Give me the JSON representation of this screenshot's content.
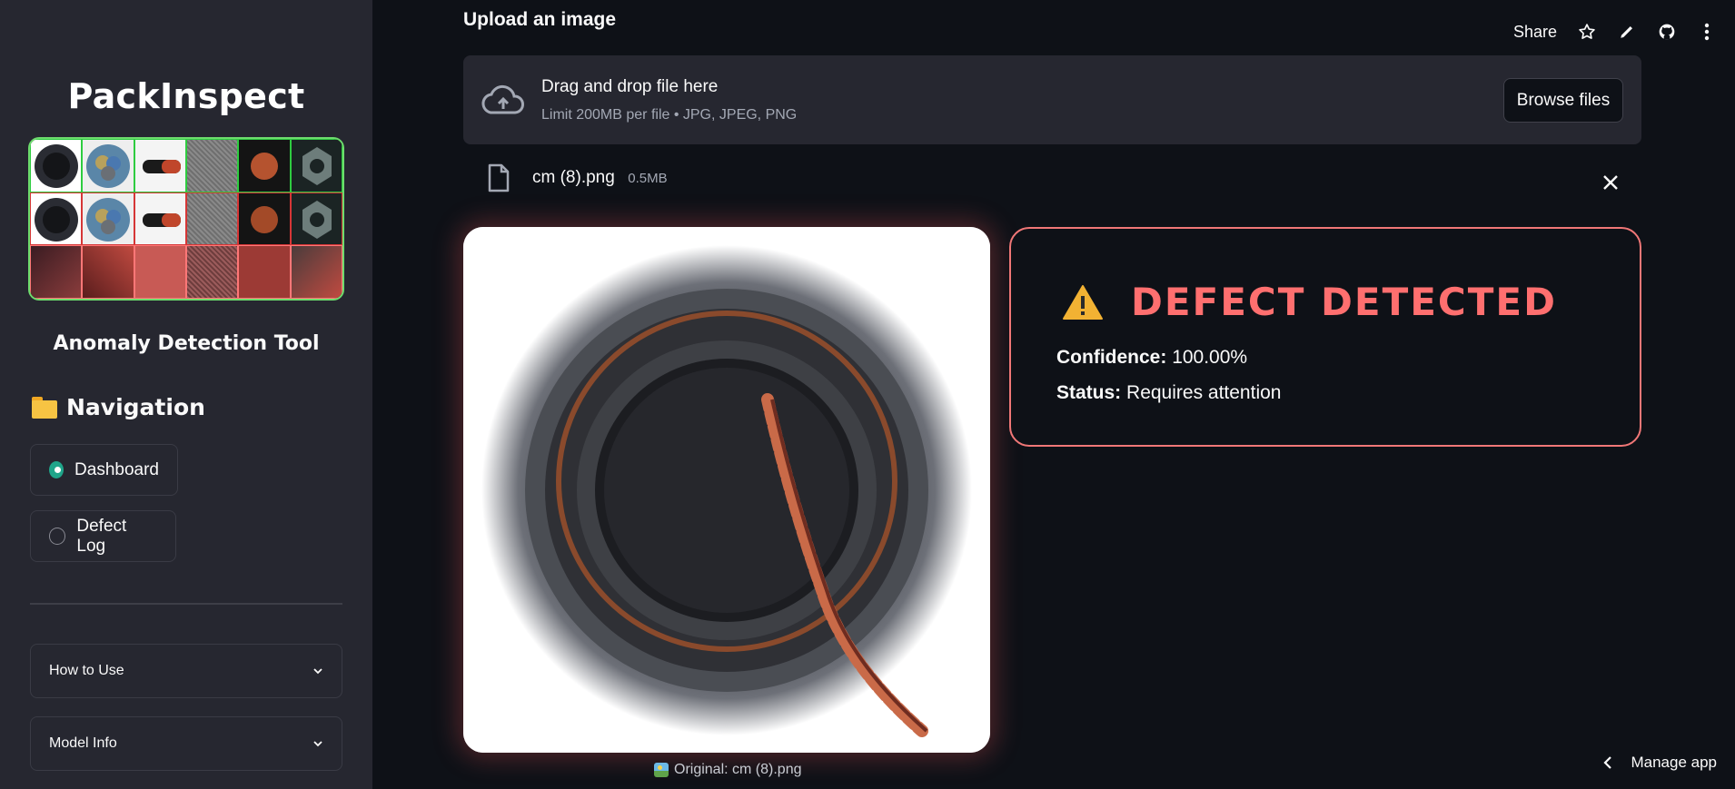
{
  "sidebar": {
    "app_title": "PackInspect",
    "subtitle": "Anomaly Detection Tool",
    "nav_heading": "Navigation",
    "nav_items": [
      {
        "label": "Dashboard",
        "selected": true
      },
      {
        "label": "Defect Log",
        "selected": false
      }
    ],
    "expanders": [
      {
        "label": "How to Use"
      },
      {
        "label": "Model Info"
      }
    ]
  },
  "toolbar": {
    "share_label": "Share"
  },
  "uploader": {
    "label": "Upload an image",
    "drop_title": "Drag and drop file here",
    "drop_subtitle": "Limit 200MB per file • JPG, JPEG, PNG",
    "browse_label": "Browse files",
    "file": {
      "name": "cm (8).png",
      "size": "0.5MB"
    }
  },
  "image": {
    "caption": "Original: cm (8).png"
  },
  "result": {
    "title": "DEFECT DETECTED",
    "confidence_label": "Confidence:",
    "confidence_value": "100.00%",
    "status_label": "Status:",
    "status_value": "Requires attention"
  },
  "footer": {
    "manage_label": "Manage app"
  },
  "colors": {
    "accent_green": "#1fa58a",
    "alert_red": "#ff6f6f",
    "sidebar_bg": "#262730",
    "main_bg": "#0e1117"
  }
}
